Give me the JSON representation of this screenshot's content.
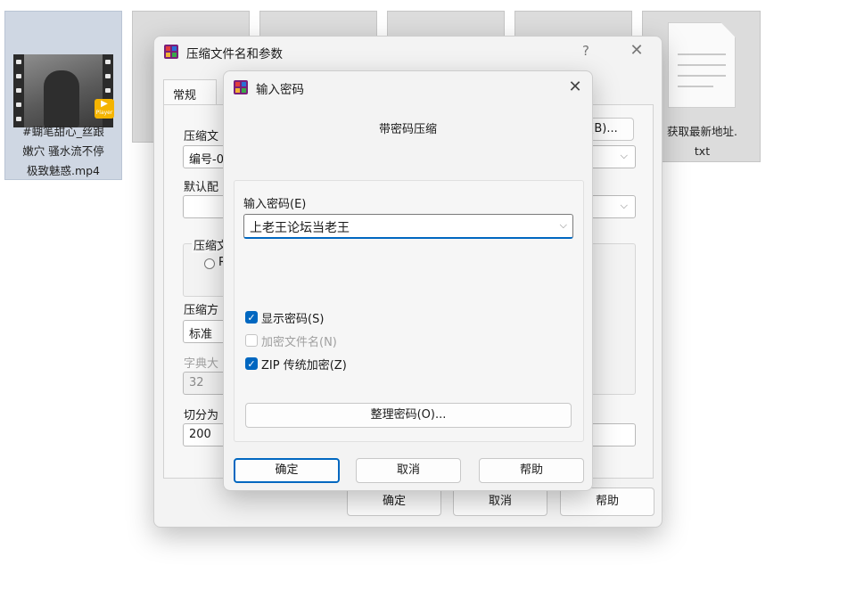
{
  "desktop": {
    "files": [
      {
        "name": "#蝴笔甜心_丝跟嫩穴 骚水流不停极致魅惑.mp4",
        "line1": "#蝴笔甜心_丝跟",
        "line2": "嫩穴 骚水流不停",
        "line3": "极致魅惑.mp4",
        "type": "video",
        "badge": "Player"
      },
      {
        "name": "获取最新地址.txt",
        "line1": "获取最新地址.",
        "line2": "txt",
        "type": "text"
      }
    ]
  },
  "archive_dialog": {
    "title": "压缩文件名和参数",
    "help_label": "?",
    "tab_general": "常规",
    "archive_name_label": "压缩文",
    "archive_name_value": "编号-0",
    "browse_label": "(B)...",
    "profile_label": "默认配",
    "format_group_label": "压缩文",
    "radio_label": "R",
    "method_label": "压缩方",
    "method_value": "标准",
    "dict_label": "字典大",
    "dict_value": "32",
    "split_label": "切分为",
    "split_value": "200",
    "ok_label": "确定",
    "cancel_label": "取消",
    "help_button_label": "帮助"
  },
  "password_dialog": {
    "title": "输入密码",
    "heading": "带密码压缩",
    "password_label": "输入密码(E)",
    "password_value": "上老王论坛当老王",
    "show_password": {
      "label": "显示密码(S)",
      "checked": true,
      "enabled": true
    },
    "encrypt_names": {
      "label": "加密文件名(N)",
      "checked": false,
      "enabled": false
    },
    "zip_legacy": {
      "label": "ZIP 传统加密(Z)",
      "checked": true,
      "enabled": true
    },
    "organize_label": "整理密码(O)...",
    "ok_label": "确定",
    "cancel_label": "取消",
    "help_label": "帮助"
  },
  "colors": {
    "accent": "#0067c0",
    "dialog_bg": "#f3f3f3"
  }
}
